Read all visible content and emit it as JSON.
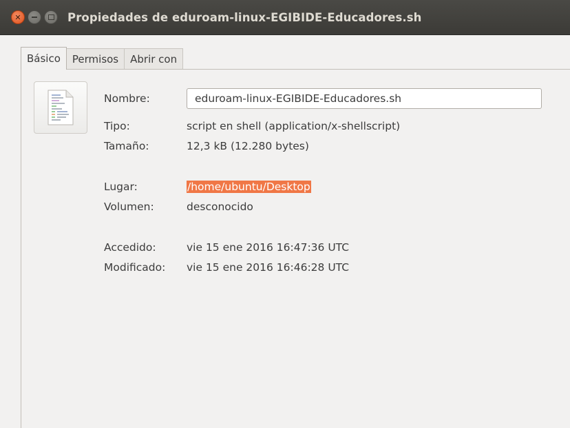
{
  "window": {
    "title": "Propiedades de eduroam-linux-EGIBIDE-Educadores.sh",
    "buttons": [
      "close-icon",
      "minimize-icon",
      "maximize-icon"
    ]
  },
  "tabs": [
    {
      "label": "Básico",
      "active": true
    },
    {
      "label": "Permisos",
      "active": false
    },
    {
      "label": "Abrir con",
      "active": false
    }
  ],
  "basic": {
    "icon": "shell-script-file-icon",
    "name_label": "Nombre:",
    "name_value": "eduroam-linux-EGIBIDE-Educadores.sh",
    "type_label": "Tipo:",
    "type_value": "script en shell (application/x-shellscript)",
    "size_label": "Tamaño:",
    "size_value": "12,3 kB (12.280 bytes)",
    "location_label": "Lugar:",
    "location_value": "/home/ubuntu/Desktop",
    "volume_label": "Volumen:",
    "volume_value": "desconocido",
    "accessed_label": "Accedido:",
    "accessed_value": "vie 15 ene 2016 16:47:36 UTC",
    "modified_label": "Modificado:",
    "modified_value": "vie 15 ene 2016 16:46:28 UTC"
  },
  "colors": {
    "titlebar": "#3c3b37",
    "close_button": "#e95420",
    "selection": "#f07746",
    "background": "#f2f1f0"
  }
}
